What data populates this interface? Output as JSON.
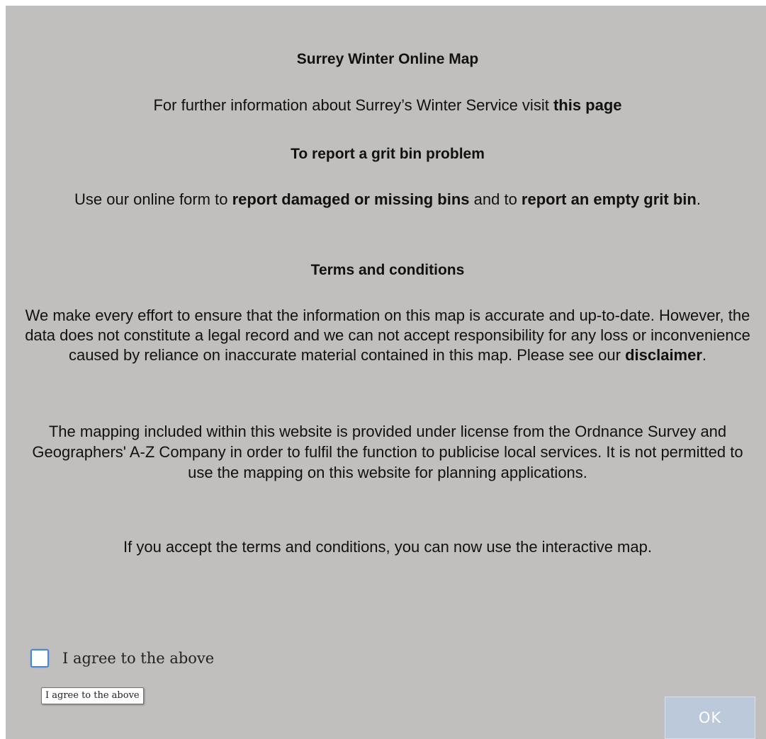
{
  "dialog": {
    "title": "Surrey Winter Online Map",
    "info": {
      "prefix": "For further information about Surrey’s Winter Service visit ",
      "link": "this page"
    },
    "grit_heading": "To report a grit bin problem",
    "grit": {
      "part1": "Use our online form to ",
      "link1": "report damaged or missing bins",
      "part2": " and to ",
      "link2": "report an empty grit bin",
      "part3": "."
    },
    "terms_heading": "Terms and conditions",
    "terms": {
      "text": "We make every effort to ensure that the information on this map is accurate and up-to-date. However, the data does not constitute a legal record and we can not accept responsibility for any loss or inconvenience caused by reliance on inaccurate material contained in this map. Please see our ",
      "link": "disclaimer",
      "end": "."
    },
    "mapping_text": "The mapping included within this website is provided under license from the Ordnance Survey and Geographers' A-Z Company in order to fulfil the function to publicise local services. It is not permitted to use the mapping on this website for planning applications.",
    "accept_text": "If you accept the terms and conditions, you can now use the interactive map."
  },
  "agree": {
    "label": "I agree to the above",
    "checked": false,
    "tooltip": "I agree to the above"
  },
  "ok_button": {
    "label": "OK",
    "enabled": false
  }
}
